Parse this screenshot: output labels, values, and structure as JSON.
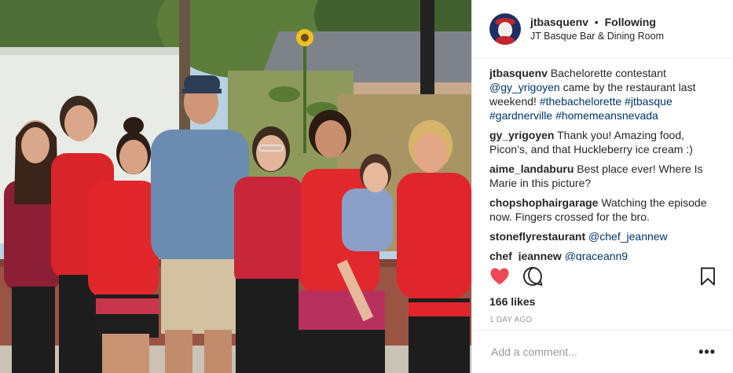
{
  "post": {
    "author": "jtbasquenv",
    "follow_status": "Following",
    "separator": "•",
    "location": "JT Basque Bar & Dining Room",
    "caption": {
      "text": "Bachelorette contestant",
      "mention": "@gy_yrigoyen",
      "text2": "came by the restaurant last weekend!",
      "hashtags": [
        "#thebachelorette",
        "#jtbasque",
        "#gardnerville",
        "#homemeansnevada"
      ]
    },
    "comments": [
      {
        "user": "gy_yrigoyen",
        "text": "Thank you! Amazing food, Picon’s, and that Huckleberry ice cream :)"
      },
      {
        "user": "aime_landaburu",
        "text": "Best place ever! Where Is Marie in this picture?"
      },
      {
        "user": "chopshophairgarage",
        "text": "Watching the episode now. Fingers crossed for the bro."
      },
      {
        "user": "stoneflyrestaurant",
        "mention": "@chef_jeannew"
      },
      {
        "user": "chef_jeannew",
        "mention": "@graceann9"
      }
    ],
    "likes": "166 likes",
    "date": "1 DAY AGO",
    "add_comment_placeholder": "Add a comment...",
    "more_label": "•••"
  },
  "icons": {
    "like": "heart-icon",
    "comment": "comment-bubble-icon",
    "save": "bookmark-icon",
    "more": "more-options-icon"
  },
  "colors": {
    "heart": "#ed4956",
    "link": "#003569",
    "meta": "#999999",
    "divider": "#efefef"
  }
}
